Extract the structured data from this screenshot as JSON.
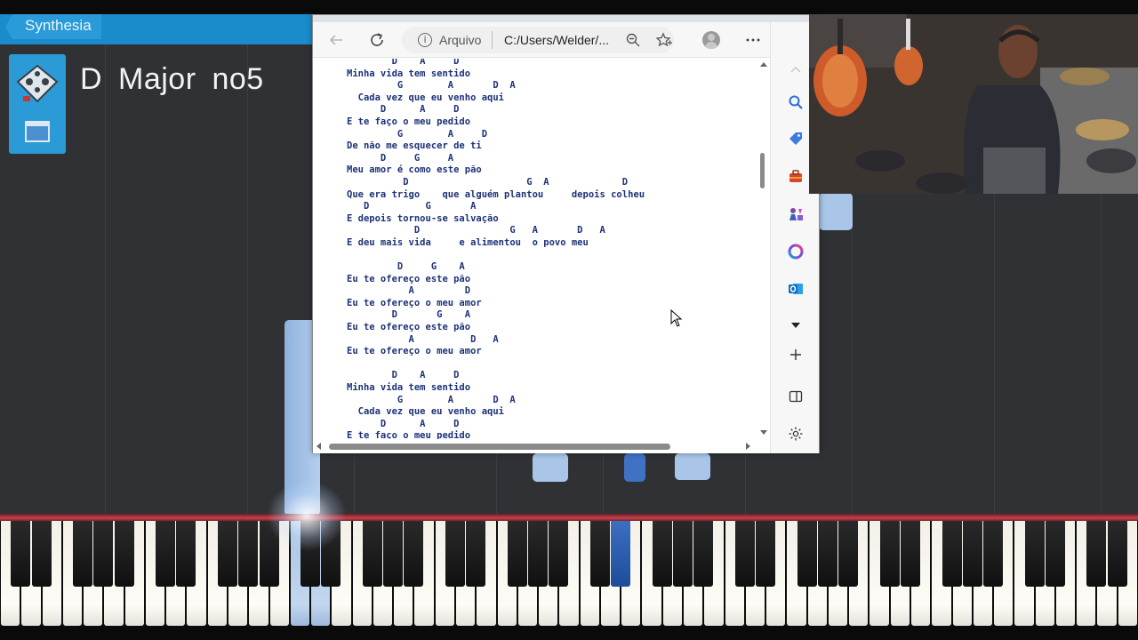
{
  "synthesia": {
    "back_label": "Synthesia",
    "chord_title": "D Major no5"
  },
  "browser": {
    "address_scheme": "Arquivo",
    "address_url": "C:/Users/Welder/...",
    "lyrics": "        D    A     D\nMinha vida tem sentido\n         G        A       D  A\n  Cada vez que eu venho aqui\n      D      A     D\nE te faço o meu pedido\n         G        A     D\nDe não me esquecer de ti\n      D     G     A\nMeu amor é como este pão\n          D                     G  A             D\nQue era trigo    que alguém plantou     depois colheu\n   D          G       A\nE depois tornou-se salvação\n            D                G   A       D   A\nE deu mais vida     e alimentou  o povo meu\n\n         D     G    A\nEu te ofereço este pão\n           A         D\nEu te ofereço o meu amor\n        D       G    A\nEu te ofereço este pão\n           A          D   A\nEu te ofereço o meu amor\n\n        D    A     D\nMinha vida tem sentido\n         G        A       D  A\n  Cada vez que eu venho aqui\n      D      A     D\nE te faço o meu pedido"
  },
  "colors": {
    "synth_header": "#1a8ccc",
    "note_light": "#a9c6e8",
    "note_dark": "#3f72c4",
    "keyboard_bar": "#c2424f",
    "lyrics_text": "#1d3278"
  },
  "icons": {
    "toolbar": [
      "back-arrow-icon",
      "refresh-icon",
      "info-icon",
      "zoom-out-icon",
      "favorites-add-icon",
      "profile-icon",
      "more-icon",
      "bing-icon"
    ],
    "sidebar": [
      "search-icon",
      "shopping-tag-icon",
      "tools-icon",
      "games-icon",
      "office-icon",
      "outlook-icon",
      "dropdown-icon",
      "add-icon",
      "split-screen-icon",
      "settings-icon"
    ]
  }
}
